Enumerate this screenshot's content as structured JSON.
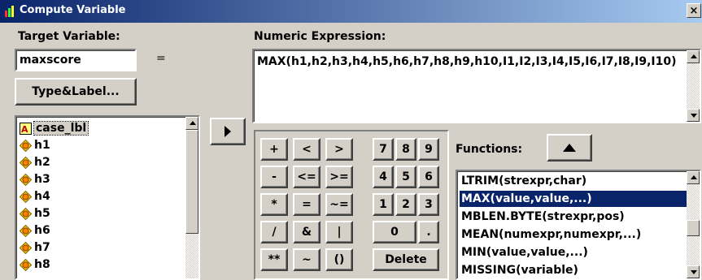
{
  "window": {
    "title": "Compute Variable",
    "close_glyph": "×"
  },
  "target": {
    "label": "Target Variable:",
    "value": "maxscore",
    "equals": "="
  },
  "type_label_button": "Type&Label...",
  "expression": {
    "label": "Numeric Expression:",
    "value": "MAX(h1,h2,h3,h4,h5,h6,h7,h8,h9,h10,I1,I2,I3,I4,I5,I6,I7,I8,I9,I10)"
  },
  "variables": [
    {
      "name": "case_lbl",
      "type": "string",
      "selected": true
    },
    {
      "name": "h1",
      "type": "numeric"
    },
    {
      "name": "h2",
      "type": "numeric"
    },
    {
      "name": "h3",
      "type": "numeric"
    },
    {
      "name": "h4",
      "type": "numeric"
    },
    {
      "name": "h5",
      "type": "numeric"
    },
    {
      "name": "h6",
      "type": "numeric"
    },
    {
      "name": "h7",
      "type": "numeric"
    },
    {
      "name": "h8",
      "type": "numeric"
    }
  ],
  "keypad": {
    "row1": [
      "+",
      "<",
      ">",
      "7",
      "8",
      "9"
    ],
    "row2": [
      "-",
      "<=",
      ">=",
      "4",
      "5",
      "6"
    ],
    "row3": [
      "*",
      "=",
      "~=",
      "1",
      "2",
      "3"
    ],
    "row4": [
      "/",
      "&",
      "|",
      "0",
      "."
    ],
    "row5": [
      "**",
      "~",
      "()",
      "Delete"
    ]
  },
  "functions": {
    "label": "Functions:",
    "items": [
      "LTRIM(strexpr,char)",
      "MAX(value,value,...)",
      "MBLEN.BYTE(strexpr,pos)",
      "MEAN(numexpr,numexpr,...)",
      "MIN(value,value,...)",
      "MISSING(variable)"
    ],
    "selected": "MAX(value,value,...)"
  },
  "icons": {
    "app": "spss-icon",
    "move": "right-arrow-icon",
    "paste_function": "up-arrow-icon"
  },
  "colors": {
    "titlebar": "#0a246a",
    "selection": "#0a246a",
    "face": "#d4d0c8"
  }
}
